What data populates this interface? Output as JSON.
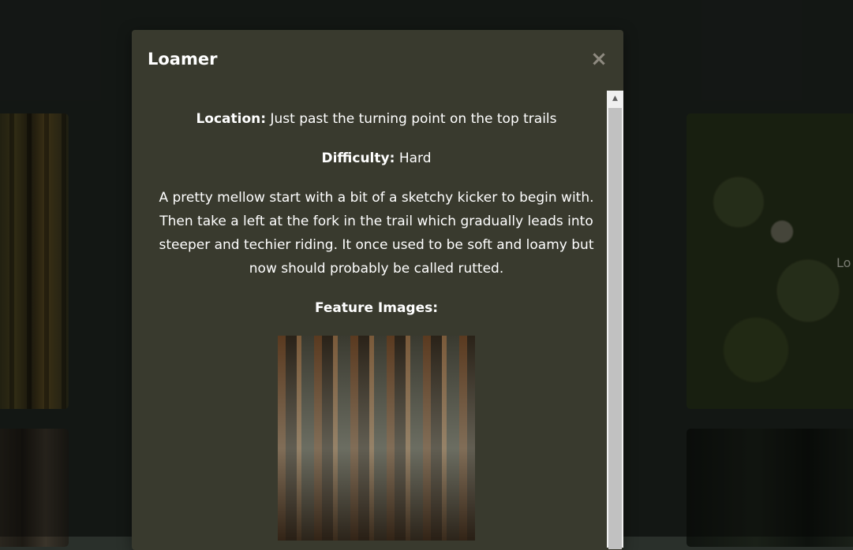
{
  "modal": {
    "title": "Loamer",
    "close_symbol": "×",
    "location_label": "Location:",
    "location_value": "Just past the turning point on the top trails",
    "difficulty_label": "Difficulty:",
    "difficulty_value": "Hard",
    "description": "A pretty mellow start with a bit of a sketchy kicker to begin with. Then take a left at the fork in the trail which gradually leads into steeper and techier riding. It once used to be soft and loamy but now should probably be called rutted.",
    "feature_images_label": "Feature Images:"
  },
  "background": {
    "right_card_label": "Lo"
  },
  "scrollbar": {
    "up_arrow": "▲"
  },
  "colors": {
    "modal_bg": "#393a2e",
    "page_bg": "#1e2420",
    "text": "#ffffff",
    "close": "#8e8a80"
  }
}
